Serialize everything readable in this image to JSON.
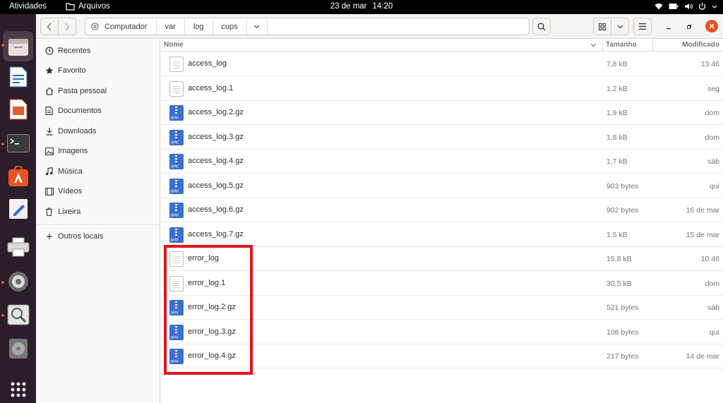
{
  "topbar": {
    "activities": "Atividades",
    "app_name": "Arquivos",
    "date": "23 de mar",
    "time": "14:20",
    "tray_icons": [
      "wifi-icon",
      "battery-icon",
      "volume-icon",
      "power-icon"
    ]
  },
  "dock": {
    "items": [
      "files-icon",
      "writer-icon",
      "impress-icon",
      "terminal-icon",
      "software-store-icon",
      "text-editor-icon",
      "printer-icon",
      "settings-icon",
      "image-viewer-icon",
      "disc-icon",
      "app-grid-icon"
    ]
  },
  "pathbar": {
    "crumbs": [
      "Computador",
      "var",
      "log",
      "cups"
    ]
  },
  "sidebar": {
    "items": [
      {
        "label": "Recentes",
        "icon": "clock-icon"
      },
      {
        "label": "Favorito",
        "icon": "star-icon"
      },
      {
        "label": "Pasta pessoal",
        "icon": "home-icon"
      },
      {
        "label": "Documentos",
        "icon": "document-icon"
      },
      {
        "label": "Downloads",
        "icon": "download-icon"
      },
      {
        "label": "Imagens",
        "icon": "image-icon"
      },
      {
        "label": "Música",
        "icon": "music-icon"
      },
      {
        "label": "Vídeos",
        "icon": "video-icon"
      },
      {
        "label": "Lixeira",
        "icon": "trash-icon"
      }
    ],
    "other": {
      "label": "Outros locais",
      "icon": "plus-icon"
    }
  },
  "columns": {
    "name": "Nome",
    "size": "Tamanho",
    "modified": "Modificado"
  },
  "files": [
    {
      "name": "access_log",
      "size": "7,8 kB",
      "modified": "13:46",
      "type": "text"
    },
    {
      "name": "access_log.1",
      "size": "1,2 kB",
      "modified": "seg",
      "type": "text"
    },
    {
      "name": "access_log.2.gz",
      "size": "1,9 kB",
      "modified": "dom",
      "type": "gz"
    },
    {
      "name": "access_log.3.gz",
      "size": "1,8 kB",
      "modified": "dom",
      "type": "gz"
    },
    {
      "name": "access_log.4.gz",
      "size": "1,7 kB",
      "modified": "sáb",
      "type": "gz"
    },
    {
      "name": "access_log.5.gz",
      "size": "903 bytes",
      "modified": "qui",
      "type": "gz"
    },
    {
      "name": "access_log.6.gz",
      "size": "902 bytes",
      "modified": "16 de mar",
      "type": "gz"
    },
    {
      "name": "access_log.7.gz",
      "size": "1,5 kB",
      "modified": "15 de mar",
      "type": "gz"
    },
    {
      "name": "error_log",
      "size": "15,8 kB",
      "modified": "10:46",
      "type": "text"
    },
    {
      "name": "error_log.1",
      "size": "30,5 kB",
      "modified": "dom",
      "type": "text"
    },
    {
      "name": "error_log.2.gz",
      "size": "521 bytes",
      "modified": "sáb",
      "type": "gz"
    },
    {
      "name": "error_log.3.gz",
      "size": "108 bytes",
      "modified": "qui",
      "type": "gz"
    },
    {
      "name": "error_log.4.gz",
      "size": "217 bytes",
      "modified": "14 de mar",
      "type": "gz"
    }
  ],
  "colors": {
    "accent": "#e95420",
    "highlight": "#e0141e",
    "gz": "#3b6fd1"
  }
}
